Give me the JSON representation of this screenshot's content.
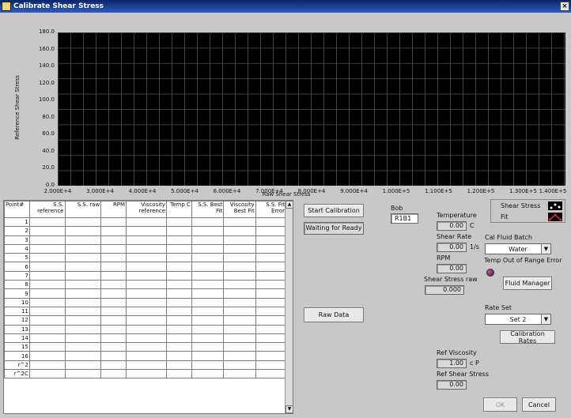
{
  "window": {
    "title": "Calibrate Shear Stress",
    "close": "×"
  },
  "chart_data": {
    "type": "scatter",
    "xlabel": "Raw Shear Stress",
    "ylabel": "Reference Shear Stress",
    "xlim": [
      20000,
      140000
    ],
    "ylim": [
      0,
      180
    ],
    "x_ticks": [
      "2.000E+4",
      "3.000E+4",
      "4.000E+4",
      "5.000E+4",
      "6.000E+4",
      "7.000E+4",
      "8.000E+4",
      "9.000E+4",
      "1.000E+5",
      "1.100E+5",
      "1.200E+5",
      "1.300E+5",
      "1.400E+5"
    ],
    "y_ticks": [
      "180.0",
      "160.0",
      "140.0",
      "120.0",
      "100.0",
      "80.0",
      "60.0",
      "40.0",
      "20.0",
      "0.0"
    ],
    "legend": [
      {
        "name": "Shear Stress"
      },
      {
        "name": "Fit"
      }
    ],
    "background": "#000000",
    "grid": true
  },
  "table": {
    "headers": [
      "Point#",
      "S.S. reference",
      "S.S. raw",
      "RPM",
      "Viscosity reference",
      "Temp C",
      "S.S. Best Fit",
      "Viscosity Best Fit",
      "S.S. Fit Error"
    ],
    "rows": [
      "1",
      "2",
      "3",
      "4",
      "5",
      "6",
      "7",
      "8",
      "9",
      "10",
      "11",
      "12",
      "13",
      "14",
      "15",
      "16",
      "r^2",
      "r^2C"
    ]
  },
  "controls": {
    "start_calibration": "Start Calibration",
    "status": "Waiting for Ready",
    "raw_data": "Raw Data",
    "bob_label": "Bob",
    "bob_value": "R1B1",
    "temperature_label": "Temperature",
    "temperature_value": "0.00",
    "temperature_unit": "C",
    "shear_rate_label": "Shear Rate",
    "shear_rate_value": "0.00",
    "shear_rate_unit": "1/s",
    "rpm_label": "RPM",
    "rpm_value": "0.00",
    "shear_stress_raw_label": "Shear Stress raw",
    "shear_stress_raw_value": "0.000",
    "cal_fluid_batch_label": "Cal Fluid Batch",
    "cal_fluid_batch_value": "Water",
    "temp_out_of_range_label": "Temp Out of Range Error",
    "fluid_manager": "Fluid Manager",
    "rate_set_label": "Rate Set",
    "rate_set_value": "Set 2",
    "calibration_rates": "Calibration Rates",
    "ref_viscosity_label": "Ref Viscosity",
    "ref_viscosity_value": "1.00",
    "ref_viscosity_unit": "c P",
    "ref_shear_stress_label": "Ref Shear Stress",
    "ref_shear_stress_value": "0.00",
    "ok": "OK",
    "cancel": "Cancel"
  }
}
